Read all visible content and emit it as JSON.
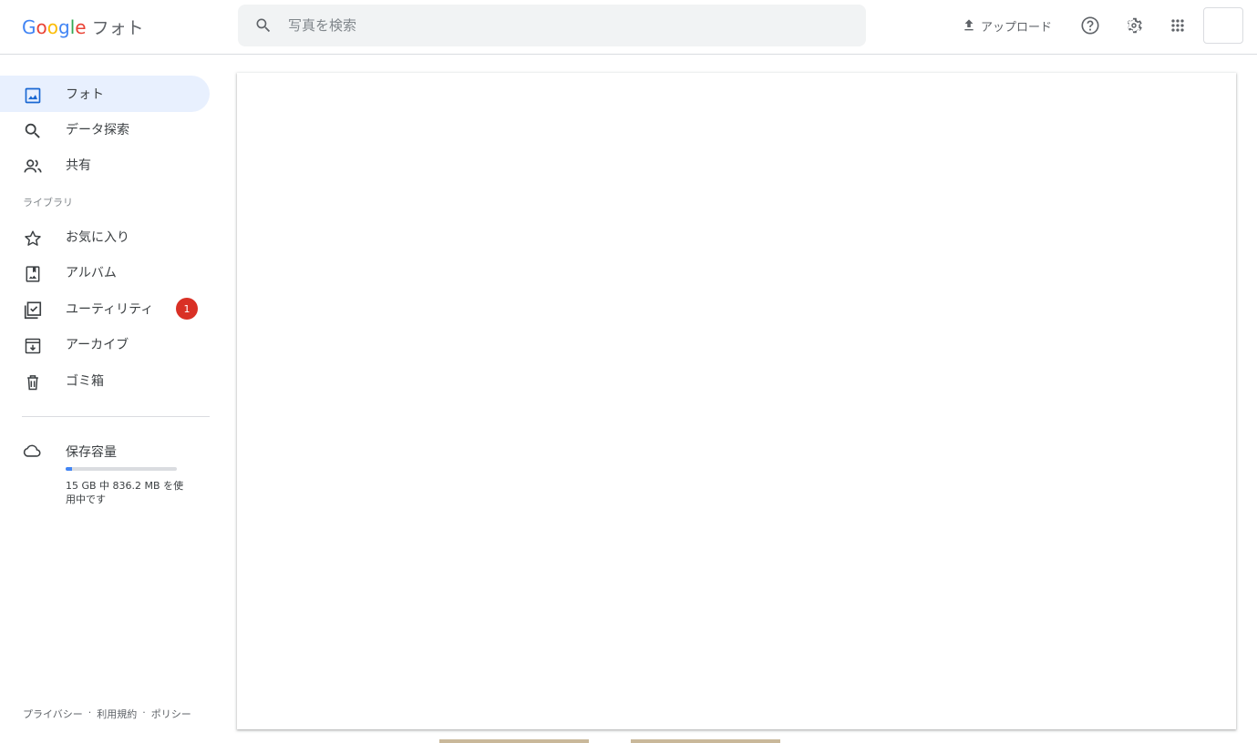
{
  "header": {
    "logo_google": [
      "G",
      "o",
      "o",
      "g",
      "l",
      "e"
    ],
    "logo_product": "フォト",
    "search_placeholder": "写真を検索",
    "upload_label": "アップロード"
  },
  "sidebar": {
    "items": [
      {
        "label": "フォト",
        "icon": "photo-icon",
        "active": true
      },
      {
        "label": "データ探索",
        "icon": "search-icon"
      },
      {
        "label": "共有",
        "icon": "people-icon"
      }
    ],
    "library_label": "ライブラリ",
    "library_items": [
      {
        "label": "お気に入り",
        "icon": "star-icon"
      },
      {
        "label": "アルバム",
        "icon": "album-icon"
      },
      {
        "label": "ユーティリティ",
        "icon": "utilities-icon",
        "badge": "1"
      },
      {
        "label": "アーカイブ",
        "icon": "archive-icon"
      },
      {
        "label": "ゴミ箱",
        "icon": "trash-icon"
      }
    ],
    "storage": {
      "title": "保存容量",
      "detail": "15 GB 中 836.2 MB を使用中です",
      "used_fraction": 0.054
    },
    "footer": {
      "privacy": "プライバシー",
      "sep1": "·",
      "terms": "利用規約",
      "sep2": "·",
      "policy": "ポリシー"
    }
  },
  "colors": {
    "accent": "#4285f4",
    "active_bg": "#e8f0fe",
    "badge": "#d93025"
  }
}
